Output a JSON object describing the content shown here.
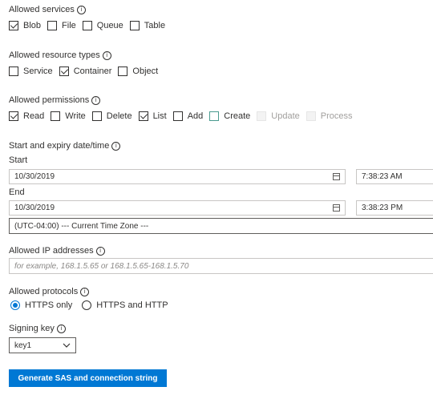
{
  "services": {
    "label": "Allowed services",
    "options": [
      {
        "label": "Blob",
        "checked": true
      },
      {
        "label": "File",
        "checked": false
      },
      {
        "label": "Queue",
        "checked": false
      },
      {
        "label": "Table",
        "checked": false
      }
    ]
  },
  "resource_types": {
    "label": "Allowed resource types",
    "options": [
      {
        "label": "Service",
        "checked": false
      },
      {
        "label": "Container",
        "checked": true
      },
      {
        "label": "Object",
        "checked": false
      }
    ]
  },
  "permissions": {
    "label": "Allowed permissions",
    "options": [
      {
        "label": "Read",
        "checked": true
      },
      {
        "label": "Write",
        "checked": false
      },
      {
        "label": "Delete",
        "checked": false
      },
      {
        "label": "List",
        "checked": true
      },
      {
        "label": "Add",
        "checked": false
      },
      {
        "label": "Create",
        "checked": false
      },
      {
        "label": "Update",
        "checked": false
      },
      {
        "label": "Process",
        "checked": false
      }
    ]
  },
  "dates": {
    "label": "Start and expiry date/time",
    "start_label": "Start",
    "start_date": "10/30/2019",
    "start_time": "7:38:23 AM",
    "end_label": "End",
    "end_date": "10/30/2019",
    "end_time": "3:38:23 PM",
    "timezone": "(UTC-04:00) --- Current Time Zone ---"
  },
  "ip": {
    "label": "Allowed IP addresses",
    "placeholder": "for example, 168.1.5.65 or 168.1.5.65-168.1.5.70"
  },
  "protocols": {
    "label": "Allowed protocols",
    "options": [
      {
        "label": "HTTPS only",
        "selected": true
      },
      {
        "label": "HTTPS and HTTP",
        "selected": false
      }
    ]
  },
  "signing": {
    "label": "Signing key",
    "value": "key1"
  },
  "generate_button": "Generate SAS and connection string",
  "colors": {
    "accent": "#0078d4",
    "focus": "#4a9b8f"
  }
}
